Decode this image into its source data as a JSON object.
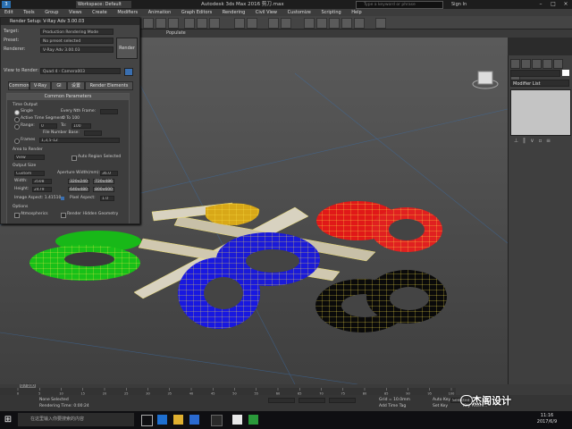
{
  "window": {
    "app_icon": "3ds-max-logo",
    "workspace": "Workspace: Default",
    "title": "Autodesk 3ds Max 2016    剪刀.max",
    "search_placeholder": "Type a keyword or phrase",
    "signin": "Sign In"
  },
  "menu": [
    "Edit",
    "Tools",
    "Group",
    "Views",
    "Create",
    "Modifiers",
    "Animation",
    "Graph Editors",
    "Rendering",
    "Civil View",
    "Customize",
    "Scripting",
    "Help"
  ],
  "ribbon": {
    "populate": "Populate"
  },
  "render_setup": {
    "title": "Render Setup: V-Ray Adv 3.00.03",
    "target_label": "Target:",
    "target_value": "Production Rendering Mode",
    "preset_label": "Preset:",
    "preset_value": "No preset selected",
    "renderer_label": "Renderer:",
    "renderer_value": "V-Ray Adv 3.00.03",
    "render_button": "Render",
    "view_label": "View to Render:",
    "view_value": "Quad 4 - Camera003",
    "tabs": [
      "Common",
      "V-Ray",
      "GI",
      "设置",
      "Render Elements"
    ],
    "common_params": "Common Parameters",
    "time_output": "Time Output",
    "single": "Single",
    "every_nth": "Every Nth Frame:",
    "active_segment": "Active Time Segment:",
    "active_range": "0 To 100",
    "range": "Range:",
    "range_from": "0",
    "range_to": "To:",
    "range_to_val": "100",
    "file_number_base": "File Number Base:",
    "frames": "Frames",
    "frames_val": "1,3,5-12",
    "area_to_render": "Area to Render",
    "area_value": "View",
    "auto_region": "Auto Region Selected",
    "output_size": "Output Size",
    "size_preset": "Custom",
    "aperture_label": "Aperture Width(mm):",
    "aperture_val": "36.0",
    "width_label": "Width:",
    "width_val": "3508",
    "height_label": "Height:",
    "height_val": "2479",
    "preset_sizes": [
      "320x240",
      "720x486",
      "640x480",
      "800x600"
    ],
    "image_aspect": "Image Aspect: 1.41510",
    "pixel_aspect_label": "Pixel Aspect:",
    "pixel_aspect_val": "1.0",
    "options": "Options",
    "atmospherics": "Atmospherics",
    "render_hidden": "Render Hidden Geometry"
  },
  "command_panel": {
    "modifier_list": "Modifier List",
    "stack_buttons": [
      "pin-stack-icon",
      "show-end-result-icon",
      "make-unique-icon",
      "remove-modifier-icon",
      "configure-sets-icon"
    ],
    "swatch_color": "#ffffff"
  },
  "viewport": {
    "scene": "scissors",
    "colors": [
      "#18c018",
      "#1818e0",
      "#e01818",
      "#0a0a0a",
      "#d8a818",
      "#d8d2c0"
    ]
  },
  "timeline": {
    "frame": "0 / 100",
    "ticks": [
      "0",
      "5",
      "10",
      "15",
      "20",
      "25",
      "30",
      "35",
      "40",
      "45",
      "50",
      "55",
      "60",
      "65",
      "70",
      "75",
      "80",
      "85",
      "90",
      "95",
      "100"
    ]
  },
  "status": {
    "selection": "None Selected",
    "render_time": "Rendering Time: 0:00:24",
    "grid": "Grid = 10.0mm",
    "auto_key": "Auto Key",
    "selected": "Selected",
    "set_key": "Set Key",
    "key_filters": "Key Filters...",
    "add_time_tag": "Add Time Tag"
  },
  "taskbar": {
    "search": "在这里输入你要搜索的内容",
    "time": "11:16",
    "date": "2017/6/9"
  },
  "watermark": "杰阁设计"
}
